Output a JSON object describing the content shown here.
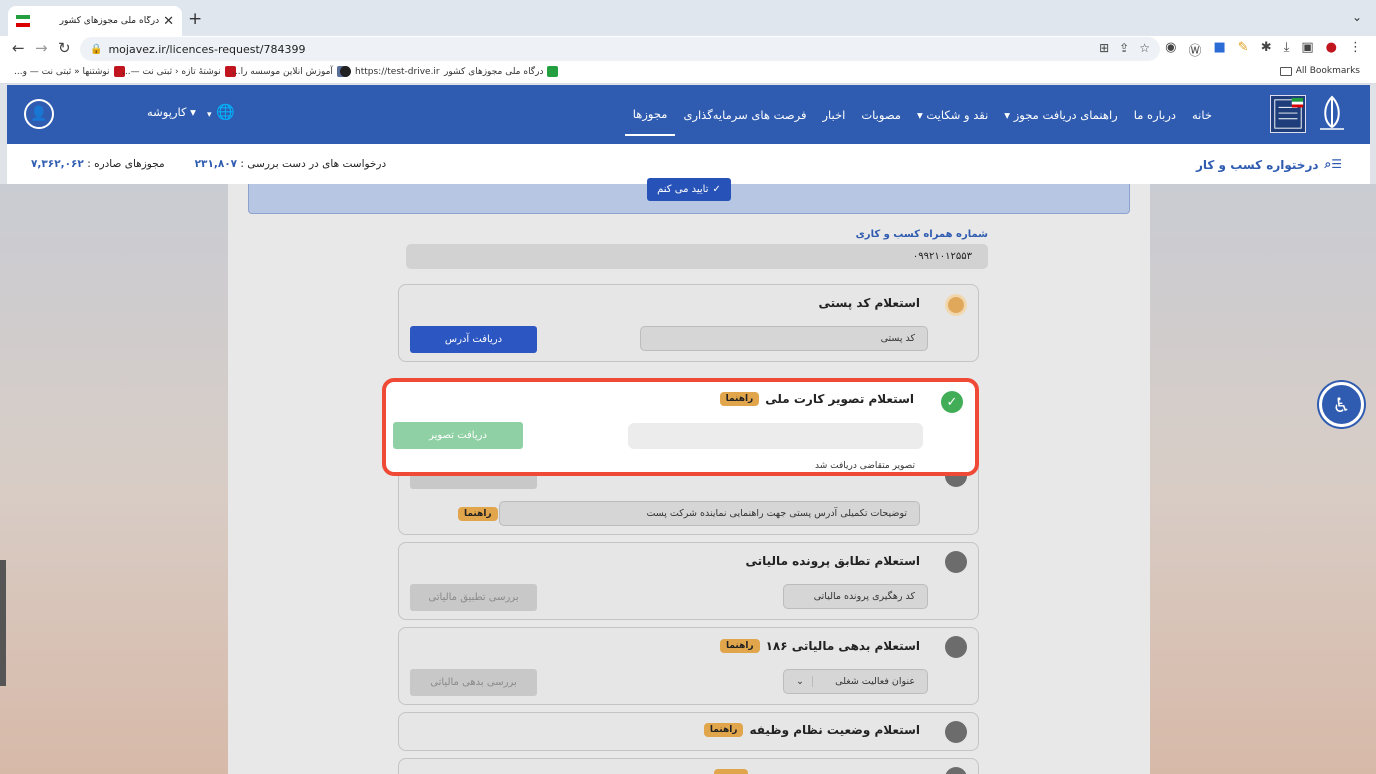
{
  "browser": {
    "tab_title": "درگاه ملی مجوزهای کشور",
    "url": "mojavez.ir/licences-request/784399",
    "bookmarks": [
      "نوشتنها « ثبتی نت — و...",
      "نوشتهٔ تازه ‹ ثبتی نت —...",
      "آموزش انلاین موسسه را...",
      "https://test-drive.ir",
      "درگاه ملی مجوزهای کشور"
    ],
    "all_bookmarks": "All Bookmarks"
  },
  "site": {
    "menu": [
      "خانه",
      "درباره ما",
      "راهنمای دریافت مجوز ▾",
      "نقد و شکایت ▾",
      "مصوبات",
      "اخبار",
      "فرصت های سرمایه‌گذاری",
      "مجوزها"
    ],
    "karpooshe": "▾ کارپوشه",
    "globe_dropdown": "▾"
  },
  "stats": {
    "business_request": "درختواره کسب و کار",
    "pending_label": "درخواست های در دست بررسی :",
    "pending_value": "۲۳۱,۸۰۷",
    "issued_label": "مجوزهای صادره :",
    "issued_value": "۷,۳۶۲,۰۶۲"
  },
  "form": {
    "confirm_button": "تایید می کنم",
    "phone_label": "شماره همراه کسب و کاری",
    "phone_value": "۰۹۹۲۱۰۱۲۵۵۳",
    "postal": {
      "title": "استعلام کد پستی",
      "placeholder": "کد پستی",
      "button": "دریافت آدرس"
    },
    "national_card": {
      "title": "استعلام تصویر کارت ملی",
      "guide": "راهنما",
      "button": "دریافت تصویر",
      "status": "تصویر متقاضی دریافت شد"
    },
    "address_notes": {
      "placeholder": "توضیحات تکمیلی آدرس پستی جهت راهنمایی نماینده شرکت پست",
      "guide": "راهنما"
    },
    "tax_file": {
      "title": "استعلام تطابق پرونده مالیاتی",
      "placeholder": "کد رهگیری پرونده مالیاتی",
      "button": "بررسی تطبیق مالیاتی"
    },
    "tax_debt": {
      "title": "استعلام بدهی مالیاتی ۱۸۶",
      "guide": "راهنما",
      "placeholder": "عنوان فعالیت شغلی",
      "button": "بررسی بدهی مالیاتی"
    },
    "military": {
      "title": "استعلام وضعیت نظام وظیفه",
      "guide": "راهنما"
    }
  },
  "colors": {
    "brand_blue": "#2f5cb0",
    "highlight_red": "#ef4a35",
    "success_green": "#42ad57",
    "guide_badge": "#e1a64c"
  }
}
